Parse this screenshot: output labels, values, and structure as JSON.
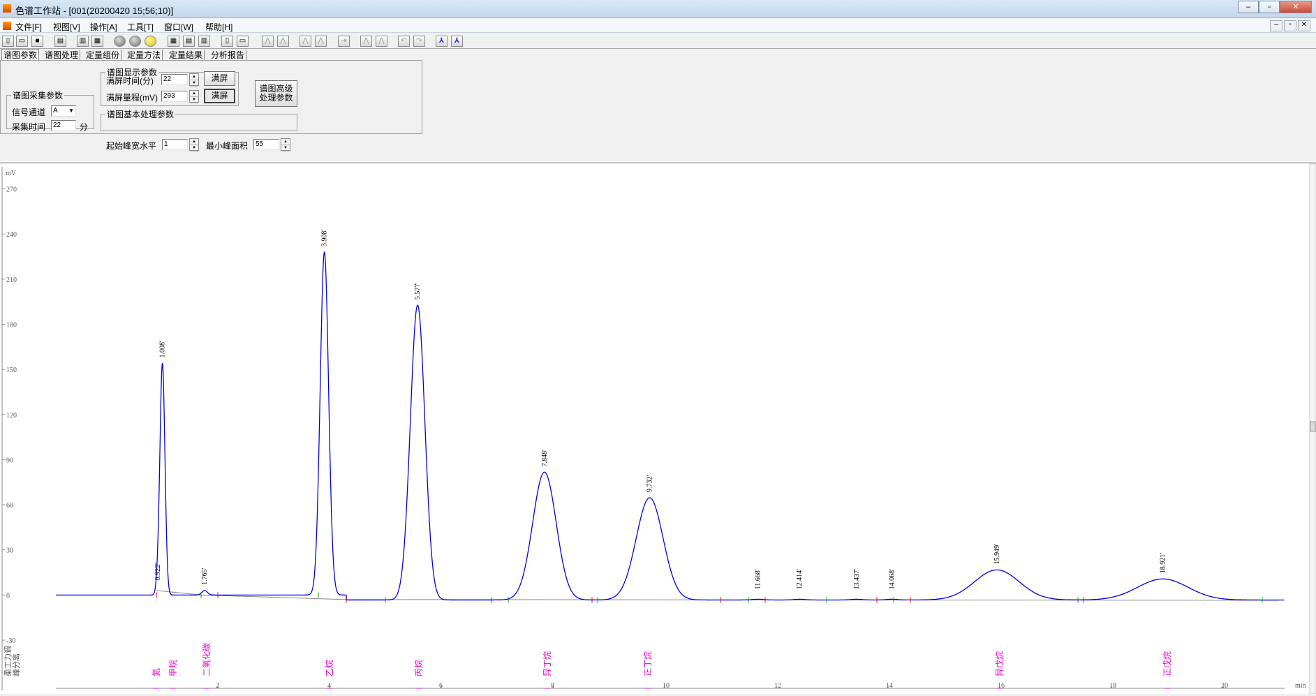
{
  "window": {
    "title": "色谱工作站 - [001(20200420 15;56;10)]"
  },
  "menu": [
    "文件[F]",
    "视图[V]",
    "操作[A]",
    "工具[T]",
    "窗口[W]",
    "帮助[H]"
  ],
  "tabs": [
    "谱图参数",
    "谱图处理",
    "定量组份",
    "定量方法",
    "定量结果",
    "分析报告"
  ],
  "acq": {
    "legend": "谱图采集参数",
    "channel_label": "信号通道",
    "channel_value": "A",
    "time_label": "采集时间",
    "time_value": "22",
    "time_unit": "分"
  },
  "display": {
    "legend": "谱图显示参数",
    "fulltime_label": "满屏时间(分)",
    "fulltime_value": "22",
    "fullrange_label": "满屏量程(mV)",
    "fullrange_value": "293",
    "fullscreen_btn": "满屏"
  },
  "advanced_btn": "谱图高级\n处理参数",
  "basic": {
    "legend": "谱图基本处理参数",
    "width_label": "起始峰宽水平",
    "width_value": "1",
    "area_label": "最小峰面积",
    "area_value": "55"
  },
  "chart_data": {
    "type": "line",
    "ylabel": "mV",
    "xlabel": "min",
    "ylim": [
      -30,
      293
    ],
    "xlim": [
      -0.9,
      21.1
    ],
    "y_ticks": [
      -30,
      0,
      30,
      60,
      90,
      120,
      150,
      180,
      210,
      240,
      270
    ],
    "x_ticks": [
      2,
      4,
      6,
      8,
      10,
      12,
      14,
      16,
      18,
      20
    ],
    "peaks": [
      {
        "rt": 0.922,
        "label": "0.922'",
        "height": 6,
        "width": 0.03
      },
      {
        "rt": 1.008,
        "label": "1.008'",
        "height": 154,
        "width": 0.045
      },
      {
        "rt": 1.765,
        "label": "1.765'",
        "height": 3,
        "width": 0.05
      },
      {
        "rt": 3.908,
        "label": "3.908'",
        "height": 228,
        "width": 0.075
      },
      {
        "rt": 5.577,
        "label": "5.577'",
        "height": 196,
        "width": 0.13
      },
      {
        "rt": 7.848,
        "label": "7.848'",
        "height": 85,
        "width": 0.21
      },
      {
        "rt": 9.732,
        "label": "9.732'",
        "height": 68,
        "width": 0.24
      },
      {
        "rt": 11.668,
        "label": "11.668'",
        "height": 0.5,
        "width": 0.1
      },
      {
        "rt": 12.414,
        "label": "12.414'",
        "height": 0.5,
        "width": 0.1
      },
      {
        "rt": 13.437,
        "label": "13.437'",
        "height": 0.5,
        "width": 0.1
      },
      {
        "rt": 14.068,
        "label": "14.068'",
        "height": 0.5,
        "width": 0.1
      },
      {
        "rt": 15.949,
        "label": "15.949'",
        "height": 20,
        "width": 0.4
      },
      {
        "rt": 18.921,
        "label": "18.921'",
        "height": 14,
        "width": 0.45
      }
    ],
    "baseline_markers": [
      0.9,
      1.7,
      2.0,
      3.8,
      4.3,
      5.0,
      6.9,
      7.2,
      8.7,
      8.8,
      11.0,
      11.5,
      11.8,
      12.9,
      13.8,
      14.1,
      14.4,
      17.4,
      17.5,
      20.7
    ],
    "components": [
      {
        "rt": 0.9,
        "name": "氮"
      },
      {
        "rt": 1.2,
        "name": "甲烷"
      },
      {
        "rt": 1.8,
        "name": "二氧化碳"
      },
      {
        "rt": 4.0,
        "name": "乙烷"
      },
      {
        "rt": 5.6,
        "name": "丙烷"
      },
      {
        "rt": 7.9,
        "name": "异丁烷"
      },
      {
        "rt": 9.7,
        "name": "正丁烷"
      },
      {
        "rt": 16.0,
        "name": "异戊烷"
      },
      {
        "rt": 19.0,
        "name": "正戊烷"
      }
    ],
    "side_labels": [
      "峰分离",
      "柔工力调"
    ],
    "line_color": "#0000ee",
    "label_color": "#ee00cc"
  }
}
